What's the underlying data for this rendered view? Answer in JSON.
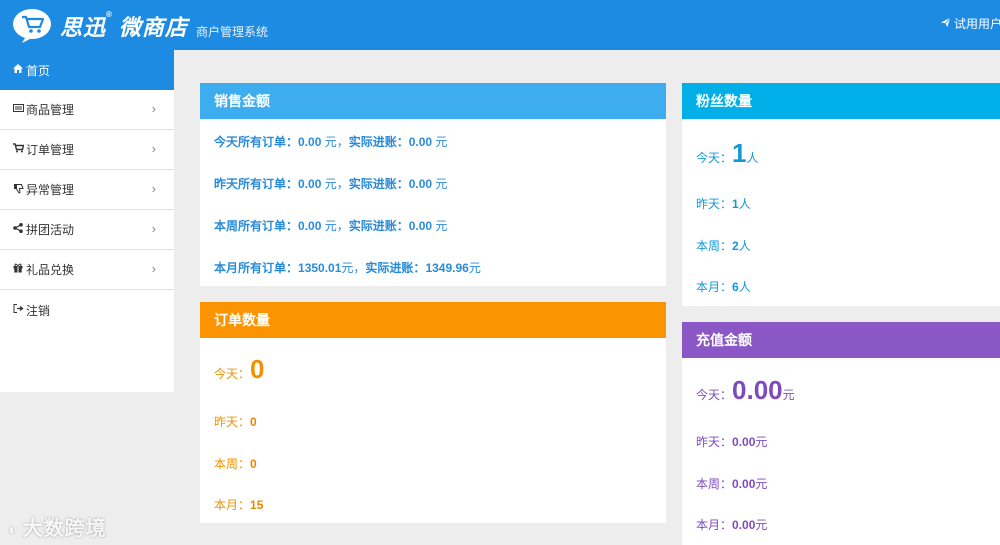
{
  "header": {
    "brand": "思迅",
    "brand_mark": "®",
    "product": "微商店",
    "subtitle": "商户管理系统",
    "trial_user": "试用用户"
  },
  "sidebar": {
    "items": [
      {
        "label": "首页",
        "icon": "home-icon",
        "active": true
      },
      {
        "label": "商品管理",
        "icon": "keyboard-icon"
      },
      {
        "label": "订单管理",
        "icon": "cart-icon"
      },
      {
        "label": "异常管理",
        "icon": "thumbs-down-icon"
      },
      {
        "label": "拼团活动",
        "icon": "share-icon"
      },
      {
        "label": "礼品兑换",
        "icon": "gift-icon"
      },
      {
        "label": "注销",
        "icon": "sign-out-icon"
      }
    ]
  },
  "sales": {
    "title": "销售金额",
    "today": {
      "prefix": "今天所有订单：",
      "amount": "0.00",
      "unit": " 元，",
      "actual_label": "实际进账：",
      "actual": "0.00",
      "unit2": " 元"
    },
    "yesterday": {
      "prefix": "昨天所有订单：",
      "amount": "0.00",
      "unit": " 元，",
      "actual_label": "实际进账：",
      "actual": "0.00",
      "unit2": " 元"
    },
    "week": {
      "prefix": "本周所有订单：",
      "amount": "0.00",
      "unit": " 元，",
      "actual_label": "实际进账：",
      "actual": "0.00",
      "unit2": " 元"
    },
    "month": {
      "prefix": "本月所有订单：",
      "amount": "1350.01",
      "unit": "元，",
      "actual_label": "实际进账：",
      "actual": "1349.96",
      "unit2": "元"
    }
  },
  "orders": {
    "title": "订单数量",
    "today_label": "今天：",
    "today": "0",
    "yesterday_label": "昨天：",
    "yesterday": "0",
    "week_label": "本周：",
    "week": "0",
    "month_label": "本月：",
    "month": "15"
  },
  "fans": {
    "title": "粉丝数量",
    "today_label": "今天：",
    "today": "1",
    "unit": "人",
    "yesterday_label": "昨天：",
    "yesterday": "1",
    "week_label": "本周：",
    "week": "2",
    "month_label": "本月：",
    "month": "6"
  },
  "recharge": {
    "title": "充值金额",
    "today_label": "今天：",
    "today": "0.00",
    "unit": "元",
    "yesterday_label": "昨天：",
    "yesterday": "0.00",
    "week_label": "本周：",
    "week": "0.00",
    "month_label": "本月：",
    "month": "0.00"
  },
  "watermark": "大数跨境",
  "colors": {
    "topbar": "#1e8be2",
    "sales": "#3dadef",
    "orders": "#fb9400",
    "fans": "#00aee8",
    "recharge": "#8a57c4"
  }
}
